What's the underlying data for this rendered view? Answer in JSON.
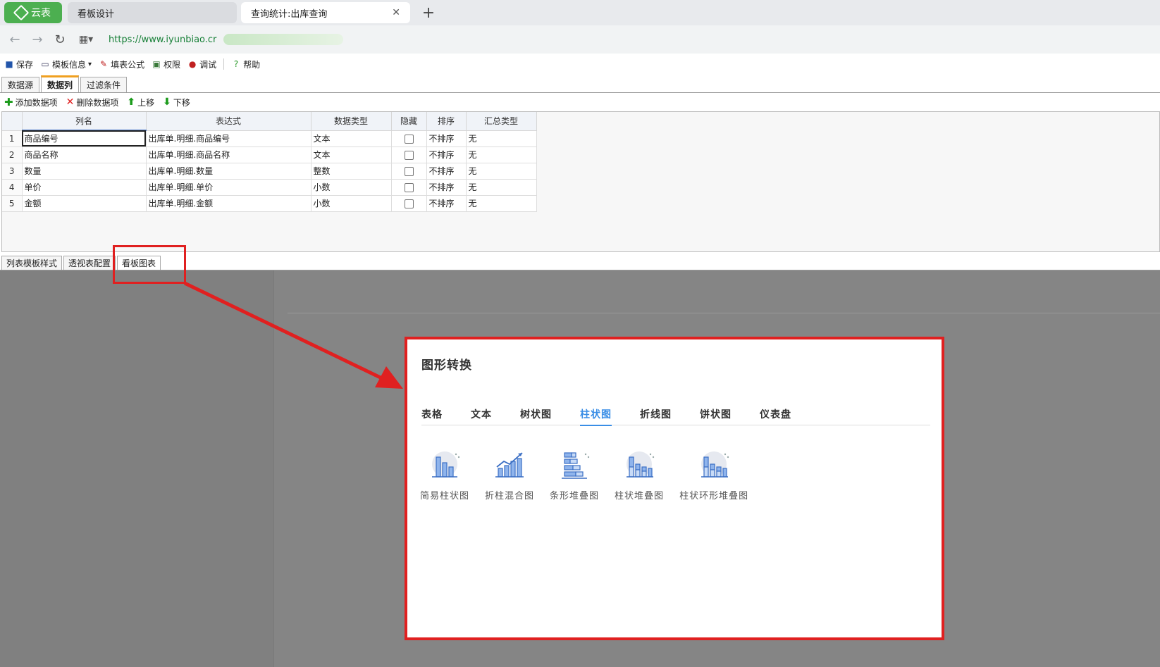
{
  "browser": {
    "app_tab_label": "云表",
    "tabs": [
      {
        "label": "看板设计",
        "active": false
      },
      {
        "label": "查询统计:出库查询",
        "active": true
      }
    ],
    "new_tab_symbol": "+",
    "url": "https://www.iyunbiao.cr"
  },
  "toolbar": {
    "items": [
      {
        "label": "保存",
        "icon": "save-icon"
      },
      {
        "label": "模板信息",
        "icon": "template-info-icon",
        "dropdown": "▾"
      },
      {
        "label": "填表公式",
        "icon": "formula-icon"
      },
      {
        "label": "权限",
        "icon": "permission-icon"
      },
      {
        "label": "调试",
        "icon": "debug-icon"
      },
      {
        "label": "帮助",
        "icon": "help-icon"
      }
    ]
  },
  "upper_tabs": [
    {
      "label": "数据源",
      "active": false
    },
    {
      "label": "数据列",
      "active": true
    },
    {
      "label": "过滤条件",
      "active": false
    }
  ],
  "sub_toolbar": {
    "add": "添加数据项",
    "delete": "删除数据项",
    "up": "上移",
    "down": "下移"
  },
  "grid": {
    "headers": [
      "列名",
      "表达式",
      "数据类型",
      "隐藏",
      "排序",
      "汇总类型"
    ],
    "rows": [
      {
        "n": "1",
        "name": "商品编号",
        "expr": "出库单.明细.商品编号",
        "type": "文本",
        "sort": "不排序",
        "agg": "无"
      },
      {
        "n": "2",
        "name": "商品名称",
        "expr": "出库单.明细.商品名称",
        "type": "文本",
        "sort": "不排序",
        "agg": "无"
      },
      {
        "n": "3",
        "name": "数量",
        "expr": "出库单.明细.数量",
        "type": "整数",
        "sort": "不排序",
        "agg": "无"
      },
      {
        "n": "4",
        "name": "单价",
        "expr": "出库单.明细.单价",
        "type": "小数",
        "sort": "不排序",
        "agg": "无"
      },
      {
        "n": "5",
        "name": "金额",
        "expr": "出库单.明细.金额",
        "type": "小数",
        "sort": "不排序",
        "agg": "无"
      }
    ]
  },
  "lower_tabs": [
    {
      "label": "列表模板样式",
      "active": false
    },
    {
      "label": "透视表配置",
      "active": false
    },
    {
      "label": "看板图表",
      "active": true
    }
  ],
  "dialog": {
    "title": "图形转换",
    "tabs": [
      {
        "label": "表格",
        "active": false
      },
      {
        "label": "文本",
        "active": false
      },
      {
        "label": "树状图",
        "active": false
      },
      {
        "label": "柱状图",
        "active": true
      },
      {
        "label": "折线图",
        "active": false
      },
      {
        "label": "饼状图",
        "active": false
      },
      {
        "label": "仪表盘",
        "active": false
      }
    ],
    "chart_types": [
      {
        "label": "简易柱状图",
        "icon": "simple-bar-chart-icon"
      },
      {
        "label": "折柱混合图",
        "icon": "line-bar-mix-chart-icon"
      },
      {
        "label": "条形堆叠图",
        "icon": "stacked-horizontal-bar-icon"
      },
      {
        "label": "柱状堆叠图",
        "icon": "stacked-bar-chart-icon"
      },
      {
        "label": "柱状环形堆叠图",
        "icon": "ring-stacked-bar-icon"
      }
    ]
  },
  "colors": {
    "accent": "#3a8ee6",
    "callout": "#e02020",
    "app_green": "#4caf50"
  }
}
